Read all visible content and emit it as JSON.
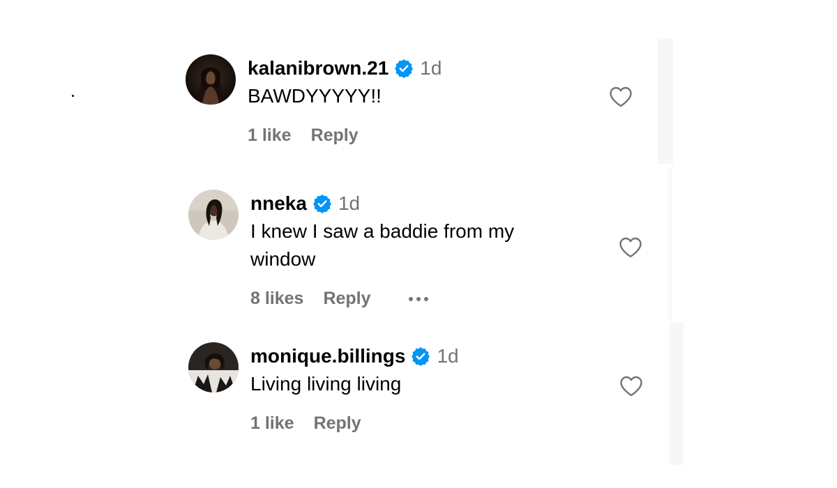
{
  "colors": {
    "verified_badge": "#0095f6",
    "secondary_text": "#737373",
    "primary_text": "#000000"
  },
  "comments": [
    {
      "username": "kalanibrown.21",
      "time": "1d",
      "text": "BAWDYYYYY!!",
      "likes": "1 like",
      "reply": "Reply",
      "verified": true,
      "avatar_icon": "profile-photo"
    },
    {
      "username": "nneka",
      "time": "1d",
      "text": "I knew I saw a baddie from my window",
      "likes": "8 likes",
      "reply": "Reply",
      "verified": true,
      "more_icon": "more-options-icon",
      "avatar_icon": "profile-photo"
    },
    {
      "username": "monique.billings",
      "time": "1d",
      "text": "Living living living",
      "likes": "1 like",
      "reply": "Reply",
      "verified": true,
      "avatar_icon": "profile-photo"
    }
  ]
}
